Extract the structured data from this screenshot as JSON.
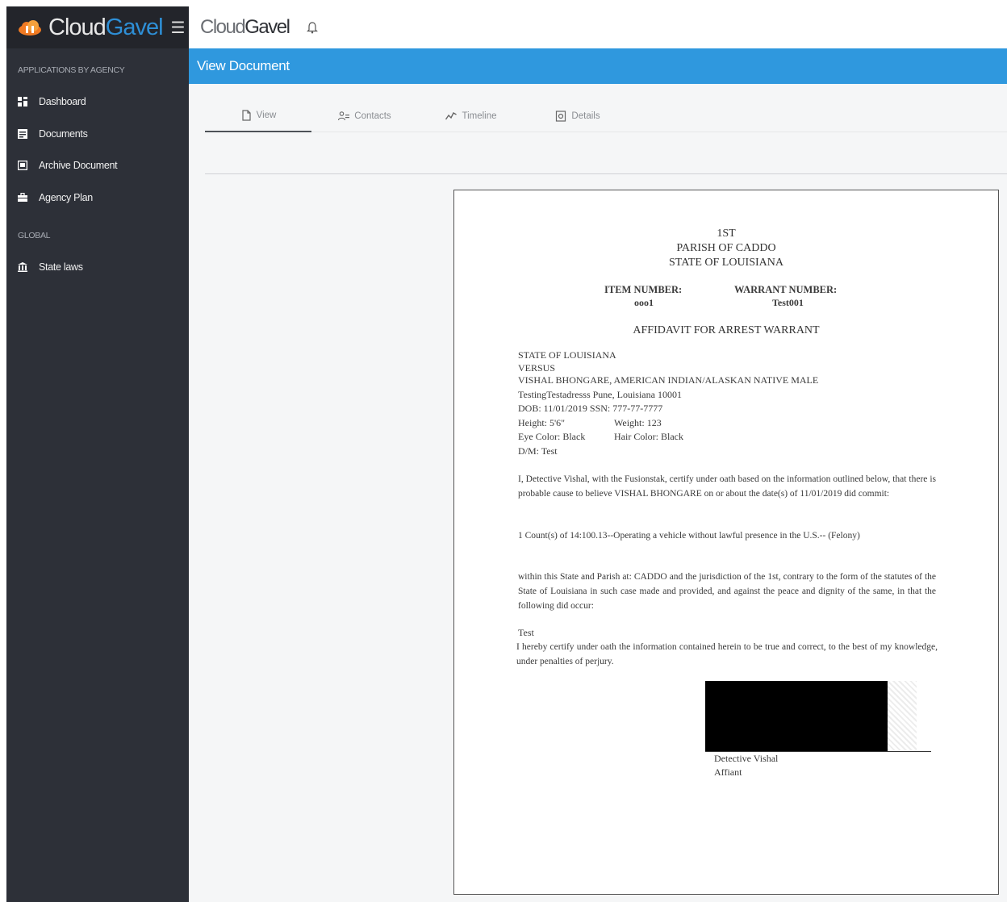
{
  "sidebar": {
    "brand_part1": "Cloud",
    "brand_part2": "Gavel",
    "menu_icon": "hamburger-icon",
    "section_agency": "APPLICATIONS BY AGENCY",
    "section_global": "GLOBAL",
    "items": [
      {
        "label": "Dashboard",
        "icon": "dashboard-icon"
      },
      {
        "label": "Documents",
        "icon": "document-icon"
      },
      {
        "label": "Archive Document",
        "icon": "archive-icon"
      },
      {
        "label": "Agency Plan",
        "icon": "briefcase-icon"
      }
    ],
    "global_items": [
      {
        "label": "State laws",
        "icon": "courthouse-icon"
      }
    ]
  },
  "topbar": {
    "title_part1": "Cloud",
    "title_part2": "Gavel",
    "bell_icon": "bell-icon"
  },
  "page": {
    "title": "View Document"
  },
  "tabs": [
    {
      "label": "View",
      "icon": "file-icon",
      "active": true
    },
    {
      "label": "Contacts",
      "icon": "contacts-icon",
      "active": false
    },
    {
      "label": "Timeline",
      "icon": "timeline-icon",
      "active": false
    },
    {
      "label": "Details",
      "icon": "details-icon",
      "active": false
    }
  ],
  "document": {
    "header": [
      "1ST",
      "PARISH OF CADDO",
      "STATE OF LOUISIANA"
    ],
    "item_number_label": "ITEM NUMBER:",
    "item_number": "ooo1",
    "warrant_number_label": "WARRANT NUMBER:",
    "warrant_number": "Test001",
    "title": "AFFIDAVIT FOR ARREST WARRANT",
    "case_lines": [
      "STATE OF LOUISIANA",
      "VERSUS",
      "VISHAL BHONGARE, AMERICAN INDIAN/ALASKAN NATIVE MALE",
      "TestingTestadresss Pune, Louisiana 10001",
      "DOB: 11/01/2019  SSN: 777-77-7777"
    ],
    "height": "Height: 5'6\"",
    "weight": "Weight: 123",
    "eye_color": "Eye Color: Black",
    "hair_color": "Hair Color: Black",
    "dm": "D/M: Test",
    "para1": "I, Detective Vishal, with the Fusionstak, certify under oath based on the information outlined below, that there is probable cause to believe VISHAL BHONGARE on or about the date(s) of 11/01/2019  did commit:",
    "para2": "1 Count(s) of 14:100.13--Operating a vehicle without lawful presence     in the U.S.-- (Felony)",
    "para3": "within this State and Parish at: CADDO  and the jurisdiction of the 1st, contrary to the form of the statutes of the State of Louisiana in such case made and provided, and against the peace and dignity of the same, in that the following did occur:",
    "test_line": "Test",
    "certify": "I hereby certify under oath the information contained herein to be true and correct, to the best of my knowledge, under penalties of perjury.",
    "signer_name": "Detective Vishal",
    "signer_role": "Affiant"
  }
}
